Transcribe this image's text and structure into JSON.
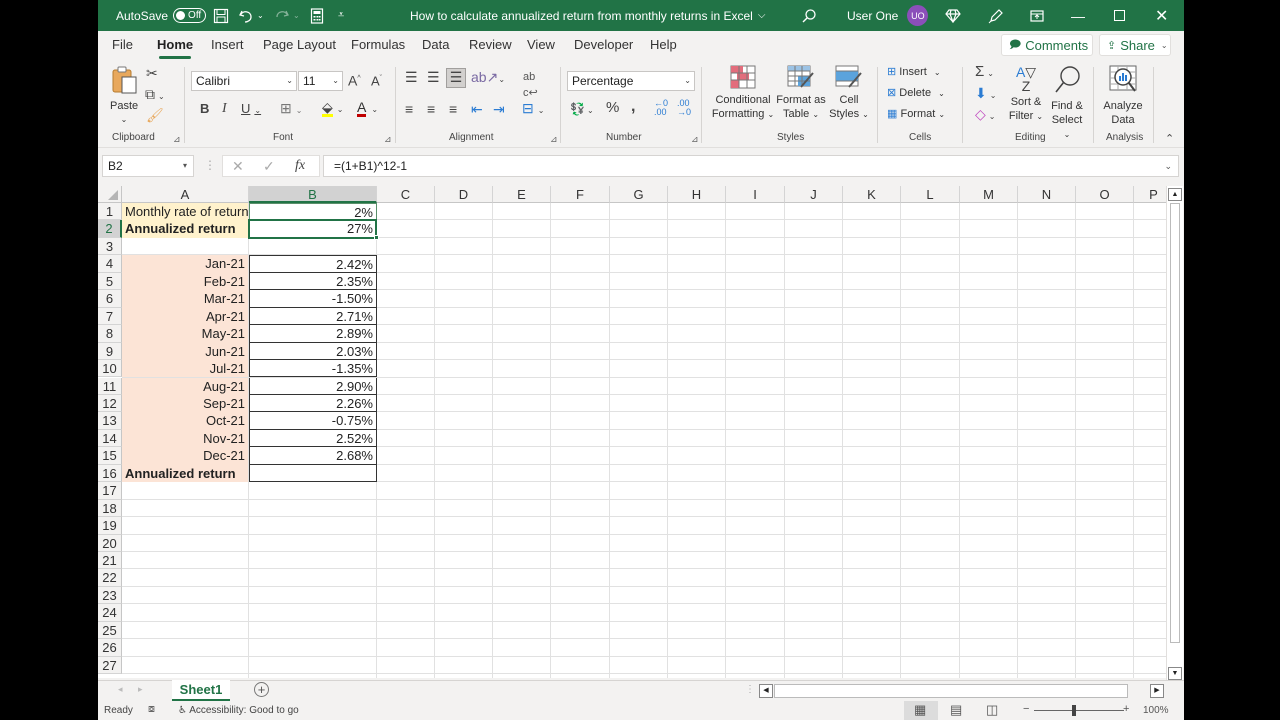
{
  "titlebar": {
    "autosave_label": "AutoSave",
    "autosave_state": "Off",
    "doc_title": "How to calculate annualized return from monthly returns in Excel",
    "user_name": "User One",
    "user_initials": "UO"
  },
  "menu": {
    "tabs": [
      "File",
      "Home",
      "Insert",
      "Page Layout",
      "Formulas",
      "Data",
      "Review",
      "View",
      "Developer",
      "Help"
    ],
    "active": "Home",
    "comments_label": "Comments",
    "share_label": "Share"
  },
  "ribbon": {
    "clipboard": {
      "label": "Clipboard",
      "paste": "Paste"
    },
    "font": {
      "label": "Font",
      "name": "Calibri",
      "size": "11"
    },
    "alignment": {
      "label": "Alignment"
    },
    "number": {
      "label": "Number",
      "format": "Percentage"
    },
    "styles": {
      "label": "Styles",
      "conditional": "Conditional",
      "conditional2": "Formatting",
      "format_table": "Format as",
      "format_table2": "Table",
      "cell_styles": "Cell",
      "cell_styles2": "Styles"
    },
    "cells": {
      "label": "Cells",
      "insert": "Insert",
      "delete": "Delete",
      "format": "Format"
    },
    "editing": {
      "label": "Editing",
      "sort": "Sort &",
      "sort2": "Filter",
      "find": "Find &",
      "find2": "Select"
    },
    "analysis": {
      "label": "Analysis",
      "analyze": "Analyze",
      "analyze2": "Data"
    }
  },
  "formula_bar": {
    "name_box": "B2",
    "formula": "=(1+B1)^12-1"
  },
  "sheet": {
    "columns": [
      "A",
      "B",
      "C",
      "D",
      "E",
      "F",
      "G",
      "H",
      "I",
      "J",
      "K",
      "L",
      "M",
      "N",
      "O",
      "P"
    ],
    "selected_column": "B",
    "selected_row": 2,
    "selected_cell": "B2",
    "rows": [
      {
        "n": 1,
        "a": "Monthly rate of return",
        "b": "2%"
      },
      {
        "n": 2,
        "a": "Annualized return",
        "b": "27%"
      },
      {
        "n": 3,
        "a": "",
        "b": ""
      },
      {
        "n": 4,
        "a": "Jan-21",
        "b": "2.42%"
      },
      {
        "n": 5,
        "a": "Feb-21",
        "b": "2.35%"
      },
      {
        "n": 6,
        "a": "Mar-21",
        "b": "-1.50%"
      },
      {
        "n": 7,
        "a": "Apr-21",
        "b": "2.71%"
      },
      {
        "n": 8,
        "a": "May-21",
        "b": "2.89%"
      },
      {
        "n": 9,
        "a": "Jun-21",
        "b": "2.03%"
      },
      {
        "n": 10,
        "a": "Jul-21",
        "b": "-1.35%"
      },
      {
        "n": 11,
        "a": "Aug-21",
        "b": "2.90%"
      },
      {
        "n": 12,
        "a": "Sep-21",
        "b": "2.26%"
      },
      {
        "n": 13,
        "a": "Oct-21",
        "b": "-0.75%"
      },
      {
        "n": 14,
        "a": "Nov-21",
        "b": "2.52%"
      },
      {
        "n": 15,
        "a": "Dec-21",
        "b": "2.68%"
      },
      {
        "n": 16,
        "a": "Annualized return",
        "b": ""
      },
      {
        "n": 17,
        "a": "",
        "b": ""
      },
      {
        "n": 18,
        "a": "",
        "b": ""
      },
      {
        "n": 19,
        "a": "",
        "b": ""
      },
      {
        "n": 20,
        "a": "",
        "b": ""
      },
      {
        "n": 21,
        "a": "",
        "b": ""
      },
      {
        "n": 22,
        "a": "",
        "b": ""
      },
      {
        "n": 23,
        "a": "",
        "b": ""
      },
      {
        "n": 24,
        "a": "",
        "b": ""
      },
      {
        "n": 25,
        "a": "",
        "b": ""
      },
      {
        "n": 26,
        "a": "",
        "b": ""
      },
      {
        "n": 27,
        "a": "",
        "b": ""
      }
    ],
    "colors": {
      "yellow_fill": "#fff2cc",
      "peach_fill": "#fce4d6",
      "accent": "#217346"
    }
  },
  "sheet_tabs": {
    "active": "Sheet1"
  },
  "status": {
    "ready": "Ready",
    "accessibility": "Accessibility: Good to go",
    "zoom": "100%",
    "zoom_minus": "−",
    "zoom_plus": "+"
  }
}
